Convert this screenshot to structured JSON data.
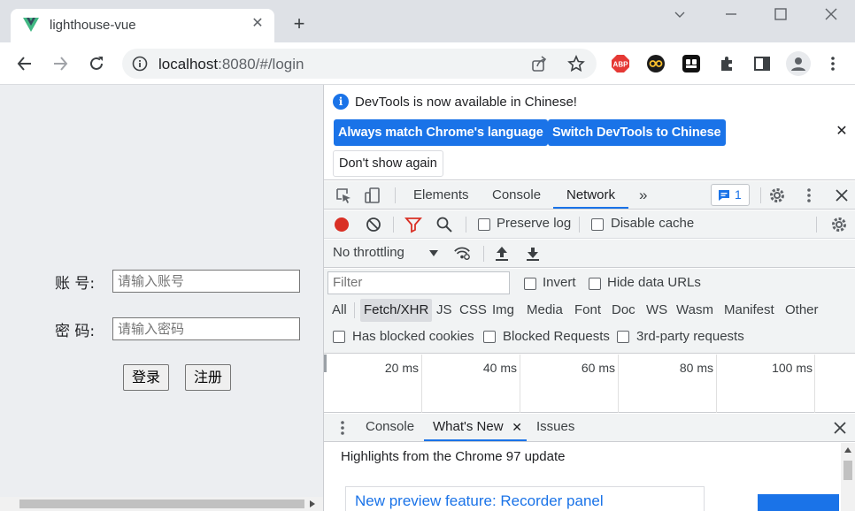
{
  "browser": {
    "tab": {
      "title": "lighthouse-vue",
      "favicon": "vue-logo-icon"
    },
    "new_tab_label": "+",
    "url_host": "localhost",
    "url_rest": ":8080/#/login",
    "window_controls": [
      "chevron-down-icon",
      "minimize-icon",
      "maximize-icon",
      "close-icon"
    ],
    "extensions": [
      "ABP",
      "extension-eyes-icon",
      "extension-dark-icon",
      "puzzle-icon",
      "side-panel-icon",
      "profile-icon",
      "menu-icon"
    ]
  },
  "page": {
    "account_label": "账 号:",
    "account_placeholder": "请输入账号",
    "password_label": "密 码:",
    "password_placeholder": "请输入密码",
    "login_button": "登录",
    "register_button": "注册"
  },
  "devtools": {
    "infobar": {
      "message": "DevTools is now available in Chinese!",
      "button_match": "Always match Chrome's language",
      "button_switch": "Switch DevTools to Chinese",
      "button_dismiss": "Don't show again"
    },
    "tabs": [
      "Elements",
      "Console",
      "Network"
    ],
    "active_tab": "Network",
    "message_count": "1",
    "network": {
      "preserve_log": "Preserve log",
      "disable_cache": "Disable cache",
      "throttling": "No throttling",
      "filter_placeholder": "Filter",
      "invert": "Invert",
      "hide_data_urls": "Hide data URLs",
      "types": [
        "All",
        "Fetch/XHR",
        "JS",
        "CSS",
        "Img",
        "Media",
        "Font",
        "Doc",
        "WS",
        "Wasm",
        "Manifest",
        "Other"
      ],
      "active_type": "Fetch/XHR",
      "has_blocked_cookies": "Has blocked cookies",
      "blocked_requests": "Blocked Requests",
      "third_party": "3rd-party requests",
      "timeline_ticks": [
        "20 ms",
        "40 ms",
        "60 ms",
        "80 ms",
        "100 ms"
      ]
    },
    "drawer": {
      "tabs": [
        "Console",
        "What's New",
        "Issues"
      ],
      "active_tab": "What's New",
      "headline": "Highlights from the Chrome 97 update",
      "feature_link": "New preview feature: Recorder panel"
    }
  },
  "colors": {
    "accent": "#1a73e8",
    "record": "#d93025",
    "filter_icon": "#d93025",
    "vue_green": "#41b883",
    "vue_dark": "#35495e"
  }
}
